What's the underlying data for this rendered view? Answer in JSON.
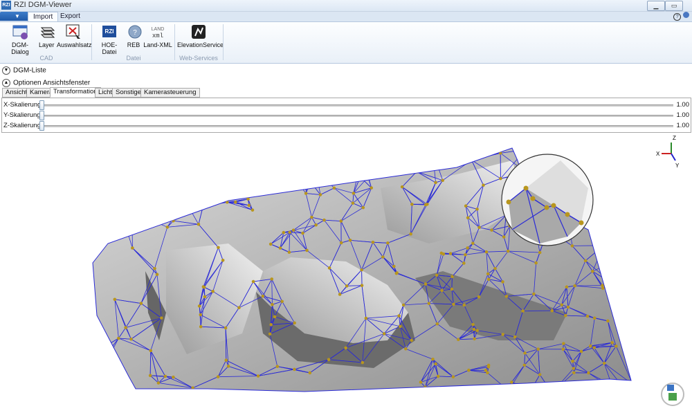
{
  "window": {
    "title": "RZI DGM-Viewer",
    "app_icon_text": "RZI",
    "minimize": "▁",
    "maximize": "▭",
    "close": "✕"
  },
  "ribbon": {
    "tabs": [
      {
        "label": "Import"
      },
      {
        "label": "Export"
      }
    ],
    "groups": [
      {
        "label": "CAD",
        "buttons": [
          {
            "label": "DGM-Dialog",
            "icon": "dgm-dialog-icon"
          },
          {
            "label": "Layer",
            "icon": "layer-icon"
          },
          {
            "label": "Auswahlsatz",
            "icon": "auswahlsatz-icon"
          }
        ]
      },
      {
        "label": "Datei",
        "buttons": [
          {
            "label": "HOE-Datei",
            "icon": "hoe-file-icon"
          },
          {
            "label": "REB",
            "icon": "reb-icon"
          },
          {
            "label": "Land-XML",
            "icon": "land-xml-icon"
          }
        ]
      },
      {
        "label": "Web-Services",
        "buttons": [
          {
            "label": "ElevationService",
            "icon": "elevation-service-icon"
          }
        ]
      }
    ],
    "hoe_icon_text": "RZI",
    "landxml_icon_text": "LAND XML"
  },
  "expanders": {
    "dgm_list": "DGM-Liste",
    "view_options": "Optionen Ansichtsfenster"
  },
  "options_tabs": [
    "Ansicht",
    "Kamera",
    "Transformation",
    "Licht",
    "Sonstiges",
    "Kamerasteuerung"
  ],
  "active_options_tab": "Transformation",
  "sliders": [
    {
      "label": "X-Skalierung",
      "value": "1.00"
    },
    {
      "label": "Y-Skalierung",
      "value": "1.00"
    },
    {
      "label": "Z-Skalierung",
      "value": "1.00"
    }
  ],
  "axes": {
    "x": "X",
    "y": "Y",
    "z": "Z"
  },
  "colors": {
    "mesh_edge": "#2a2ad6",
    "vertex": "#b8961e",
    "surface": "#a8a8a8",
    "ribbon_accent": "#2f6bb3"
  }
}
